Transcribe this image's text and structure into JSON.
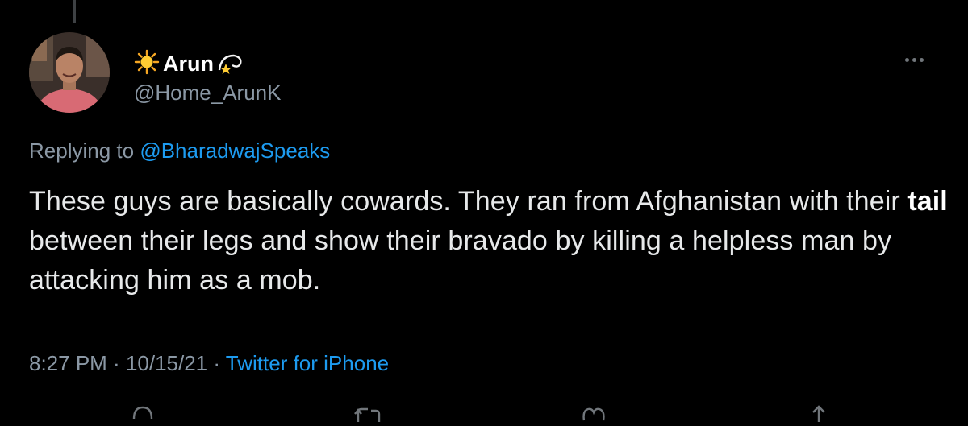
{
  "author": {
    "display_name": "Arun",
    "handle": "@Home_ArunK",
    "name_prefix_icon": "sun-emoji-icon",
    "name_suffix_icon": "dizzy-star-emoji-icon"
  },
  "reply": {
    "prefix": "Replying to ",
    "mention": "@BharadwajSpeaks"
  },
  "tweet": {
    "text_before": "These guys are basically cowards. They ran from Afghanistan with their ",
    "text_bold": "tail",
    "text_after": " between their legs and show their bravado by killing a helpless man by attacking him as a mob."
  },
  "meta": {
    "time": "8:27 PM",
    "sep1": " · ",
    "date": "10/15/21",
    "sep2": " · ",
    "source": "Twitter for iPhone"
  },
  "actions": {
    "icons": [
      "reply-icon",
      "retweet-icon",
      "like-icon",
      "share-icon"
    ]
  },
  "colors": {
    "background": "#000000",
    "text": "#e7e9ea",
    "secondary": "#8b98a5",
    "link": "#1d9bf0"
  }
}
